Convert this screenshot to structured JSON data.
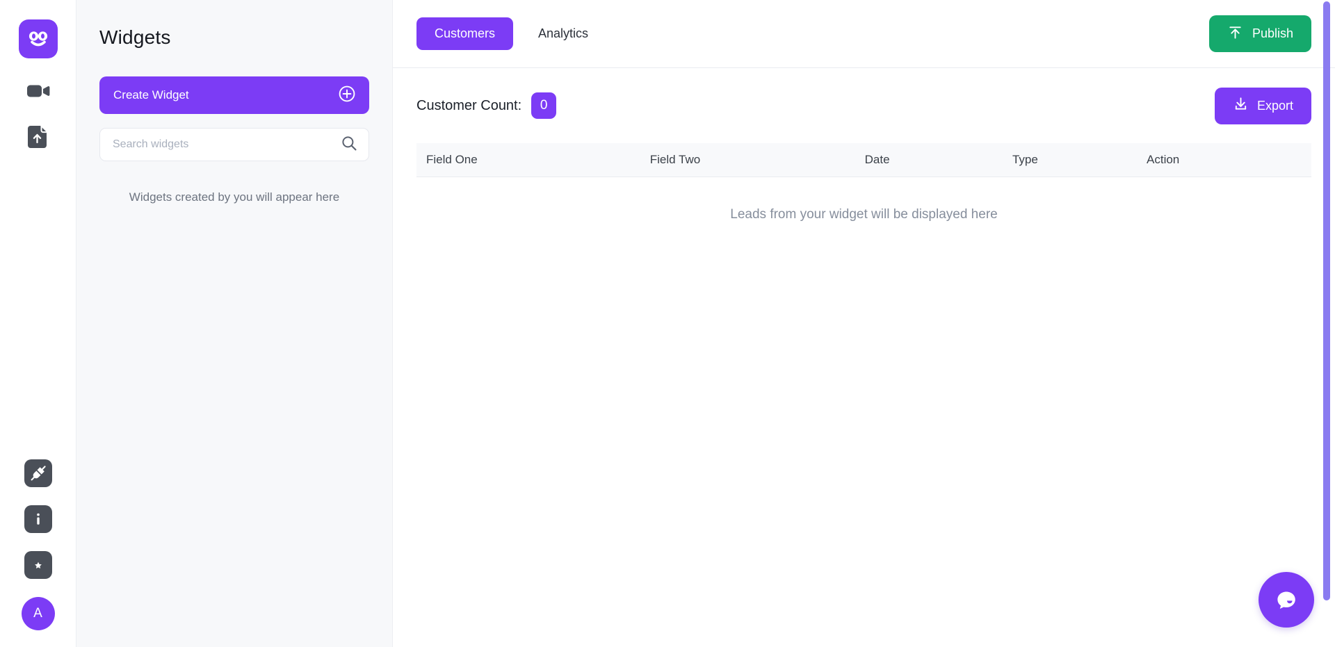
{
  "rail": {
    "logo_icon": "owl-face-logo-icon",
    "items": [
      {
        "icon": "video-camera-icon",
        "name": "video-recorder"
      },
      {
        "icon": "file-upload-icon",
        "name": "file-upload"
      }
    ],
    "bottom_items": [
      {
        "icon": "plug-integration-icon",
        "name": "integrations"
      },
      {
        "icon": "info-icon",
        "name": "info"
      },
      {
        "icon": "ticket-star-icon",
        "name": "tickets"
      }
    ],
    "avatar_initial": "A"
  },
  "widgets_panel": {
    "title": "Widgets",
    "create_button_label": "Create Widget",
    "create_button_icon": "plus-circle-icon",
    "search_placeholder": "Search widgets",
    "search_value": "",
    "search_icon": "search-icon",
    "empty_text": "Widgets created by you will appear here"
  },
  "topbar": {
    "tabs": [
      {
        "label": "Customers",
        "active": true
      },
      {
        "label": "Analytics",
        "active": false
      }
    ],
    "publish_label": "Publish",
    "publish_icon": "upload-icon",
    "publish_color": "#15a96c"
  },
  "content": {
    "count_label": "Customer Count:",
    "count_value": "0",
    "count_badge_color": "#7c3cf5",
    "export_label": "Export",
    "export_icon": "download-icon",
    "table": {
      "columns": [
        "Field One",
        "Field Two",
        "Date",
        "Type",
        "Action"
      ],
      "rows": [],
      "empty_text": "Leads from your widget will be displayed here"
    }
  },
  "chat": {
    "icon": "chat-bubble-icon",
    "color": "#7c3cf5"
  },
  "theme": {
    "accent": "#7c3cf5",
    "panel_bg": "#f7f8fa",
    "scrollbar": "#8a7bf0"
  }
}
